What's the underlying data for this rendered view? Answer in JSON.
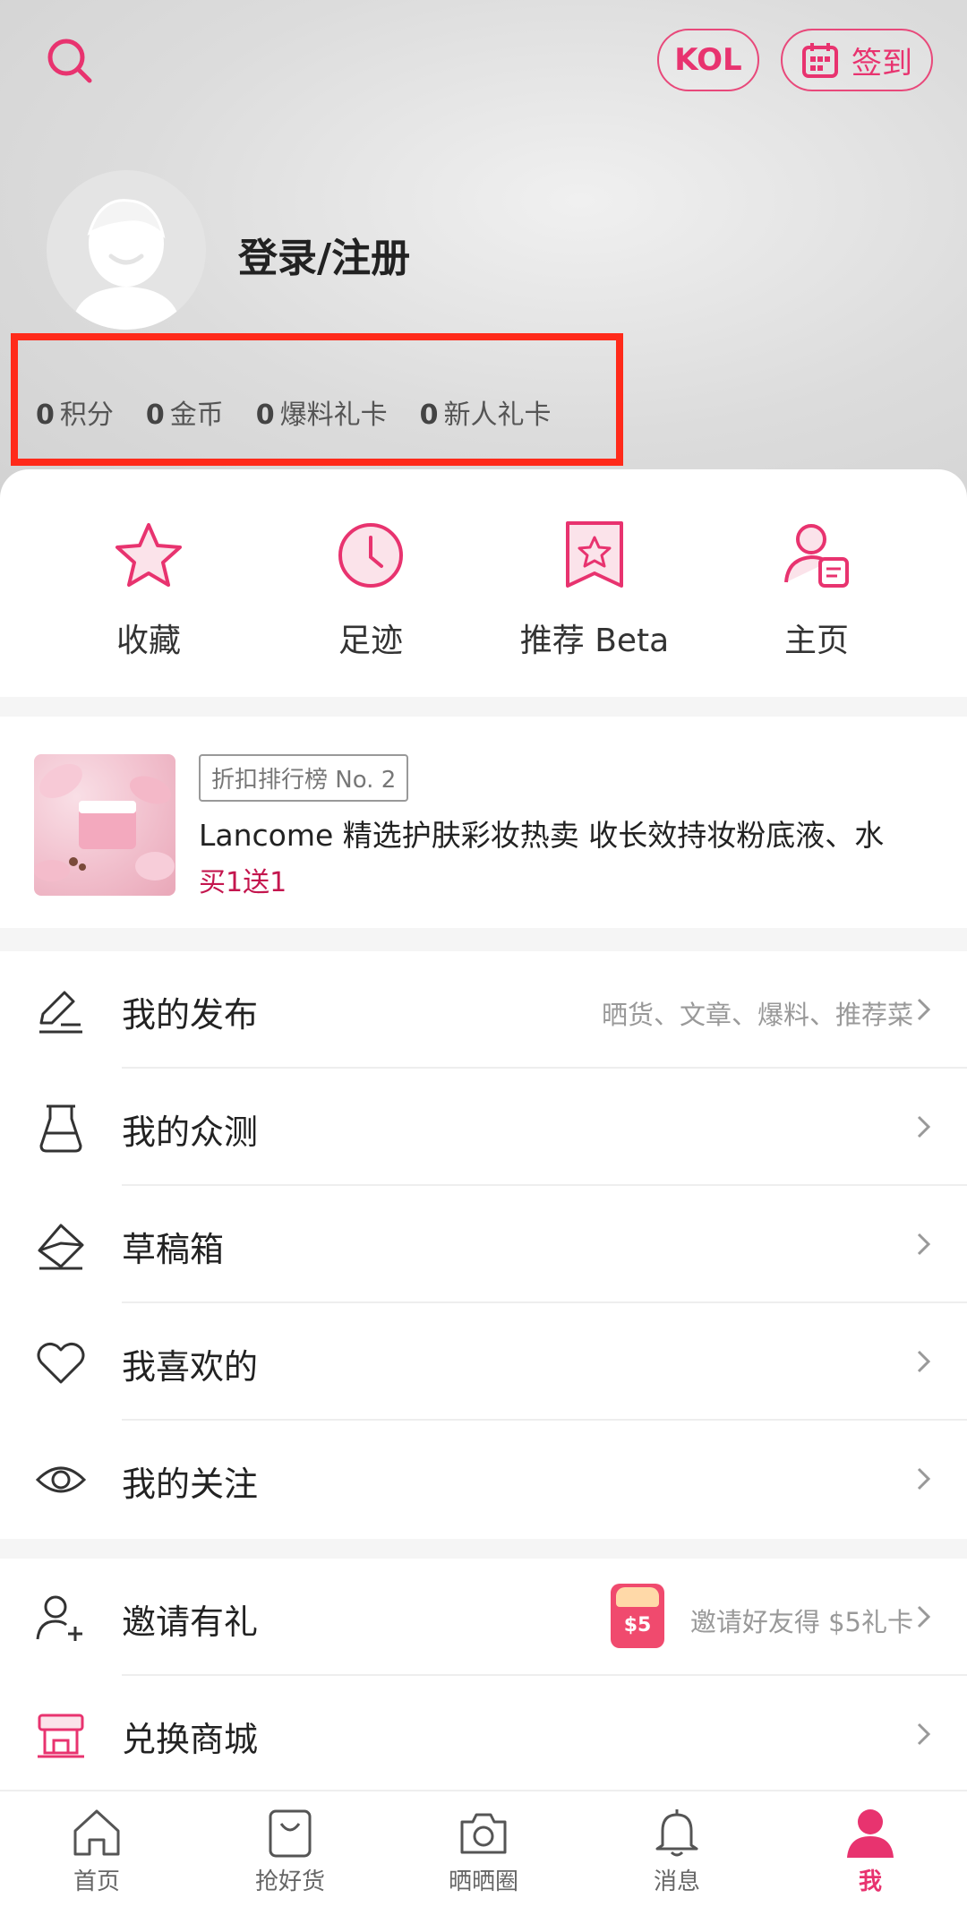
{
  "header": {
    "search_icon": "search-icon",
    "kol_label": "KOL",
    "checkin_label": "签到",
    "login_text": "登录/注册",
    "accent": "#e8336f"
  },
  "stats": [
    {
      "value": "0",
      "label": "积分"
    },
    {
      "value": "0",
      "label": "金币"
    },
    {
      "value": "0",
      "label": "爆料礼卡"
    },
    {
      "value": "0",
      "label": "新人礼卡"
    }
  ],
  "quick_actions": [
    {
      "label": "收藏",
      "icon": "star-icon"
    },
    {
      "label": "足迹",
      "icon": "clock-icon"
    },
    {
      "label": "推荐 Beta",
      "icon": "bookmark-star-icon"
    },
    {
      "label": "主页",
      "icon": "profile-card-icon"
    }
  ],
  "promo": {
    "tag": "折扣排行榜 No. 2",
    "title": "Lancome 精选护肤彩妆热卖  收长效持妆粉底液、水",
    "subtitle": "买1送1"
  },
  "menu": [
    {
      "label": "我的发布",
      "sub": "晒货、文章、爆料、推荐菜",
      "icon": "edit-pen-icon"
    },
    {
      "label": "我的众测",
      "sub": "",
      "icon": "flask-icon"
    },
    {
      "label": "草稿箱",
      "sub": "",
      "icon": "draft-envelope-icon"
    },
    {
      "label": "我喜欢的",
      "sub": "",
      "icon": "heart-icon"
    },
    {
      "label": "我的关注",
      "sub": "",
      "icon": "eye-icon"
    }
  ],
  "menu2": [
    {
      "label": "邀请有礼",
      "sub": "邀请好友得 $5礼卡",
      "badge": "$5",
      "icon": "add-user-icon"
    },
    {
      "label": "兑换商城",
      "sub": "",
      "icon": "shop-icon"
    }
  ],
  "tabs": [
    {
      "label": "首页",
      "icon": "home-icon"
    },
    {
      "label": "抢好货",
      "icon": "shopping-bag-icon"
    },
    {
      "label": "晒晒圈",
      "icon": "camera-icon"
    },
    {
      "label": "消息",
      "icon": "bell-icon"
    },
    {
      "label": "我",
      "icon": "user-icon",
      "active": true
    }
  ]
}
